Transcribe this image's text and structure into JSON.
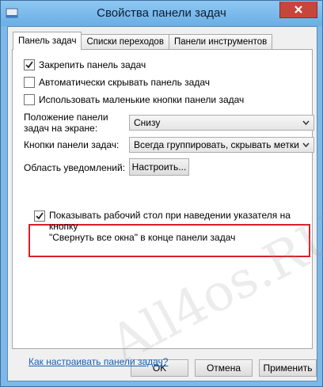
{
  "window": {
    "title": "Свойства панели задач"
  },
  "tabs": [
    {
      "label": "Панель задач"
    },
    {
      "label": "Списки переходов"
    },
    {
      "label": "Панели инструментов"
    }
  ],
  "options": {
    "lock_taskbar": {
      "label": "Закрепить панель задач",
      "checked": true
    },
    "auto_hide": {
      "label": "Автоматически скрывать панель задач",
      "checked": false
    },
    "small_buttons": {
      "label": "Использовать маленькие кнопки панели задач",
      "checked": false
    },
    "peek": {
      "label": "Показывать рабочий стол при наведении указателя на кнопку \"Свернуть все окна\" в конце панели задач",
      "label_line1": "Показывать рабочий стол при наведении указателя на кнопку",
      "label_line2": "\"Свернуть все окна\" в конце панели задач",
      "checked": true
    }
  },
  "position": {
    "label_line1": "Положение панели",
    "label_line2": "задач на экране:",
    "value": "Снизу"
  },
  "grouping": {
    "label": "Кнопки панели задач:",
    "value": "Всегда группировать, скрывать метки"
  },
  "notification": {
    "label": "Область уведомлений:",
    "button": "Настроить..."
  },
  "help_link": "Как настраивать панели задач?",
  "buttons": {
    "ok": "OK",
    "cancel": "Отмена",
    "apply": "Применить"
  },
  "watermark": "All4os.RU",
  "colors": {
    "accent_red": "#d8202a",
    "link": "#1a5fb4",
    "close": "#c7463c"
  }
}
